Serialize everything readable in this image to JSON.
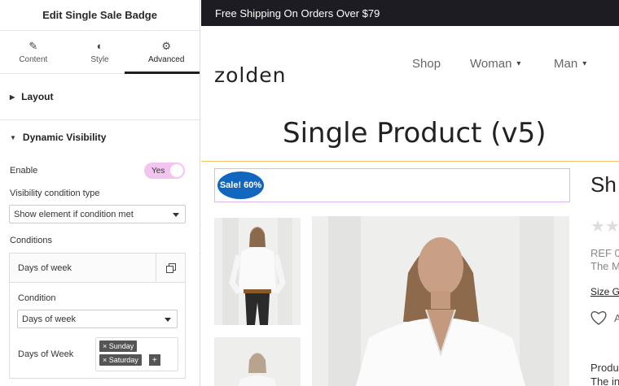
{
  "panel": {
    "title": "Edit Single Sale Badge",
    "tabs": [
      {
        "label": "Content",
        "icon": "pencil-icon"
      },
      {
        "label": "Style",
        "icon": "half-circle-icon"
      },
      {
        "label": "Advanced",
        "icon": "gear-icon",
        "active": true
      }
    ],
    "sections": {
      "layout": "Layout",
      "dynamic_visibility": "Dynamic Visibility"
    },
    "enable_label": "Enable",
    "enable_toggle": "Yes",
    "visibility_type_label": "Visibility condition type",
    "visibility_type_value": "Show element if condition met",
    "conditions_label": "Conditions",
    "repeater_item_title": "Days of week",
    "condition_label": "Condition",
    "condition_value": "Days of week",
    "days_label": "Days of Week",
    "days_tags": [
      "Sunday",
      "Saturday"
    ],
    "tag_remove": "×",
    "tag_add": "+"
  },
  "preview": {
    "shipping_banner": "Free Shipping On Orders Over $79",
    "logo": "zolden",
    "nav": [
      {
        "label": "Shop"
      },
      {
        "label": "Woman",
        "dropdown": true
      },
      {
        "label": "Man",
        "dropdown": true
      }
    ],
    "page_title": "Single Product (v5)",
    "sale_badge": "Sale! 60%",
    "product_title_partial": "Sh",
    "rating_partial": "★★",
    "ref_partial": "REF 0",
    "the_partial": "The M",
    "size_guide_partial": "Size Gu",
    "wishlist_partial": "A",
    "produ_partial": "Produ",
    "thein_partial": "The in",
    "accent_color": "#1067bd"
  }
}
